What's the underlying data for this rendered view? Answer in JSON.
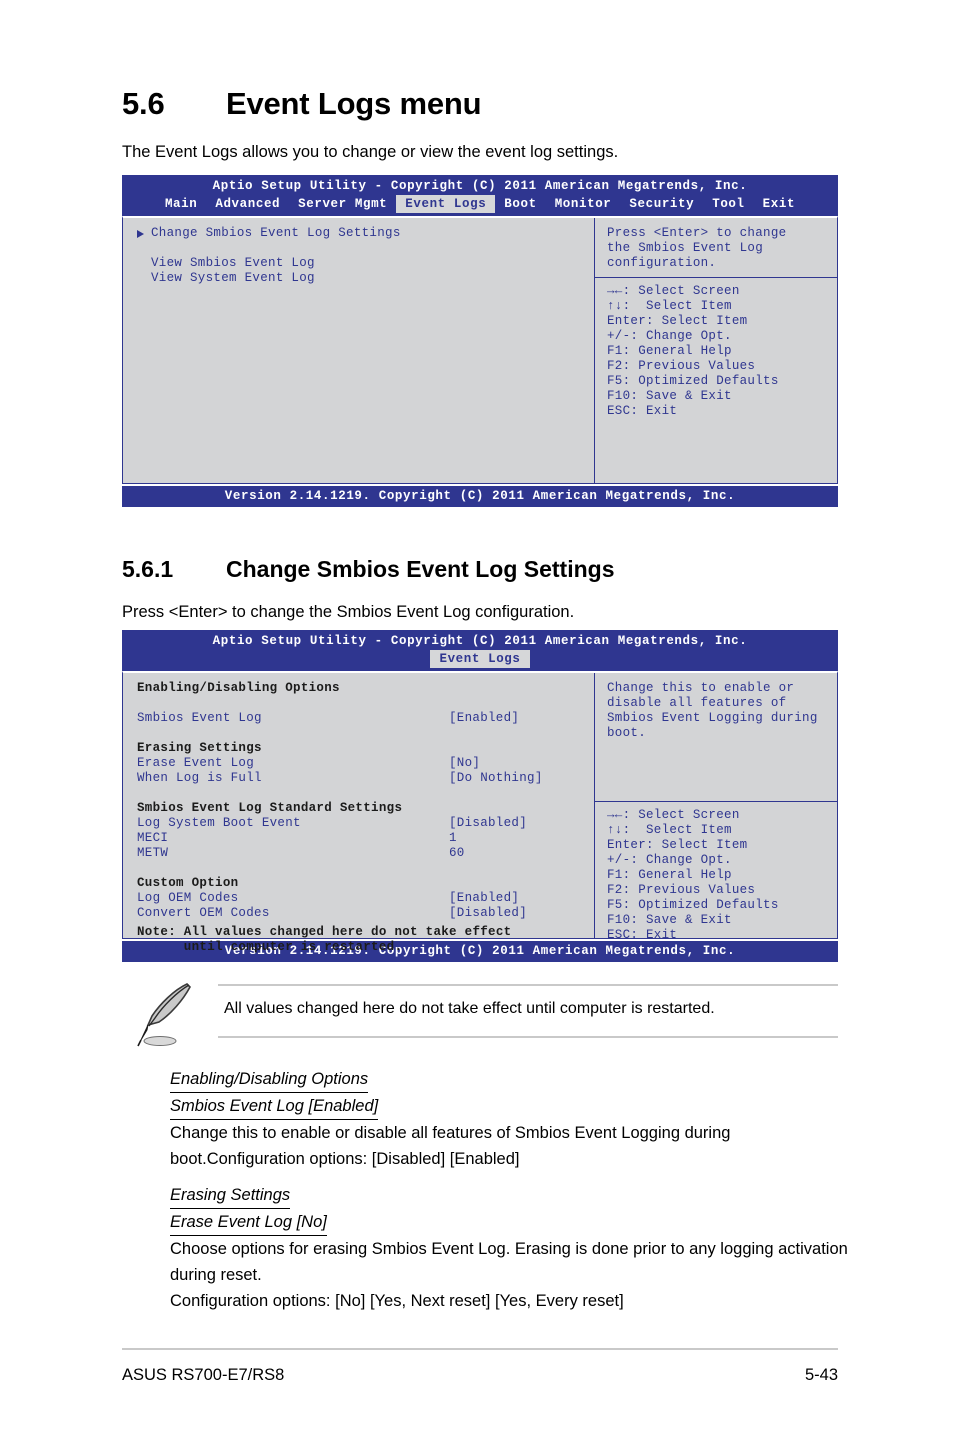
{
  "document": {
    "section_56": {
      "number": "5.6",
      "title": "Event Logs menu",
      "intro": "The Event Logs allows you to change or view the event log settings."
    },
    "section_561": {
      "number": "5.6.1",
      "title": "Change Smbios Event Log Settings",
      "intro": "Press <Enter> to change the Smbios Event Log configuration."
    },
    "note": {
      "icon": "quill-pen-icon",
      "text": "All values changed here do not take effect until computer is restarted."
    },
    "paragraphs": [
      {
        "heading1": "Enabling/Disabling Options",
        "heading2": "Smbios Event Log [Enabled]",
        "body": "Change this to enable or disable all features of Smbios Event Logging during boot.Configuration options: [Disabled] [Enabled]"
      },
      {
        "heading1": "Erasing Settings",
        "heading2": "Erase Event Log [No]",
        "body_line1": "Choose options for erasing Smbios Event Log. Erasing is done prior to any logging activation during reset.",
        "body_line2": "Configuration options: [No] [Yes, Next reset] [Yes, Every reset]"
      }
    ],
    "footer": {
      "left": "ASUS RS700-E7/RS8",
      "page": "5-43"
    }
  },
  "bios1": {
    "titlebar": "Aptio Setup Utility - Copyright (C) 2011 American Megatrends, Inc.",
    "tabs": [
      {
        "label": "Main",
        "active": false
      },
      {
        "label": "Advanced",
        "active": false
      },
      {
        "label": "Server Mgmt",
        "active": false
      },
      {
        "label": "Event Logs",
        "active": true
      },
      {
        "label": "Boot",
        "active": false
      },
      {
        "label": "Monitor",
        "active": false
      },
      {
        "label": "Security",
        "active": false
      },
      {
        "label": "Tool",
        "active": false
      },
      {
        "label": "Exit",
        "active": false
      }
    ],
    "menu": [
      {
        "label": "Change Smbios Event Log Settings",
        "submenu": true
      },
      {
        "label": "",
        "submenu": false
      },
      {
        "label": "View Smbios Event Log",
        "submenu": false
      },
      {
        "label": "View System Event Log",
        "submenu": false
      }
    ],
    "help": [
      "Press <Enter> to change",
      "the Smbios Event Log",
      "configuration."
    ],
    "nav": [
      "→←: Select Screen",
      "↑↓:  Select Item",
      "Enter: Select Item",
      "+/-: Change Opt.",
      "F1: General Help",
      "F2: Previous Values",
      "F5: Optimized Defaults",
      "F10: Save & Exit",
      "ESC: Exit"
    ],
    "footer": "Version 2.14.1219. Copyright (C) 2011 American Megatrends, Inc."
  },
  "bios2": {
    "titlebar": "Aptio Setup Utility - Copyright (C) 2011 American Megatrends, Inc.",
    "tabs": [
      {
        "label": "Event Logs",
        "active": true
      }
    ],
    "groups": [
      {
        "group": "Enabling/Disabling Options",
        "rows": [
          {
            "label": "Smbios Event Log",
            "value": "[Enabled]"
          }
        ]
      },
      {
        "group": "Erasing Settings",
        "rows": [
          {
            "label": "Erase Event Log",
            "value": "[No]"
          },
          {
            "label": "When Log is Full",
            "value": "[Do Nothing]"
          }
        ]
      },
      {
        "group": "Smbios Event Log Standard Settings",
        "rows": [
          {
            "label": "Log System Boot Event",
            "value": "[Disabled]"
          },
          {
            "label": "MECI",
            "value": "1"
          },
          {
            "label": "METW",
            "value": "60"
          }
        ]
      },
      {
        "group": "Custom Option",
        "rows": [
          {
            "label": "Log OEM Codes",
            "value": "[Enabled]"
          },
          {
            "label": "Convert OEM Codes",
            "value": "[Disabled]"
          }
        ]
      }
    ],
    "note_lines": [
      "Note: All values changed here do not take effect",
      "      until computer is restarted."
    ],
    "help": [
      "Change this to enable or",
      "disable all features of",
      "Smbios Event Logging during",
      "boot."
    ],
    "nav": [
      "→←: Select Screen",
      "↑↓:  Select Item",
      "Enter: Select Item",
      "+/-: Change Opt.",
      "F1: General Help",
      "F2: Previous Values",
      "F5: Optimized Defaults",
      "F10: Save & Exit",
      "ESC: Exit"
    ],
    "footer": "Version 2.14.1219. Copyright (C) 2011 American Megatrends, Inc."
  },
  "colors": {
    "bios_blue": "#2f3690",
    "bios_panel": "#d3d4d6",
    "rule_gray": "#c9c9c9"
  }
}
